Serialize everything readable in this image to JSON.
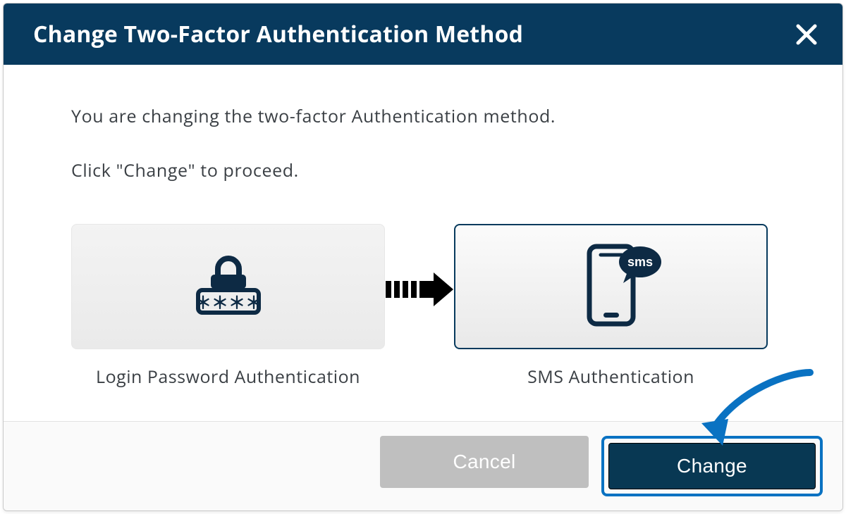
{
  "header": {
    "title": "Change Two-Factor Authentication Method"
  },
  "body": {
    "line1": "You are changing the two-factor Authentication method.",
    "line2": "Click \"Change\" to proceed."
  },
  "methods": {
    "current_label": "Login Password Authentication",
    "new_label": "SMS Authentication",
    "sms_badge": "sms"
  },
  "footer": {
    "cancel_label": "Cancel",
    "change_label": "Change"
  }
}
